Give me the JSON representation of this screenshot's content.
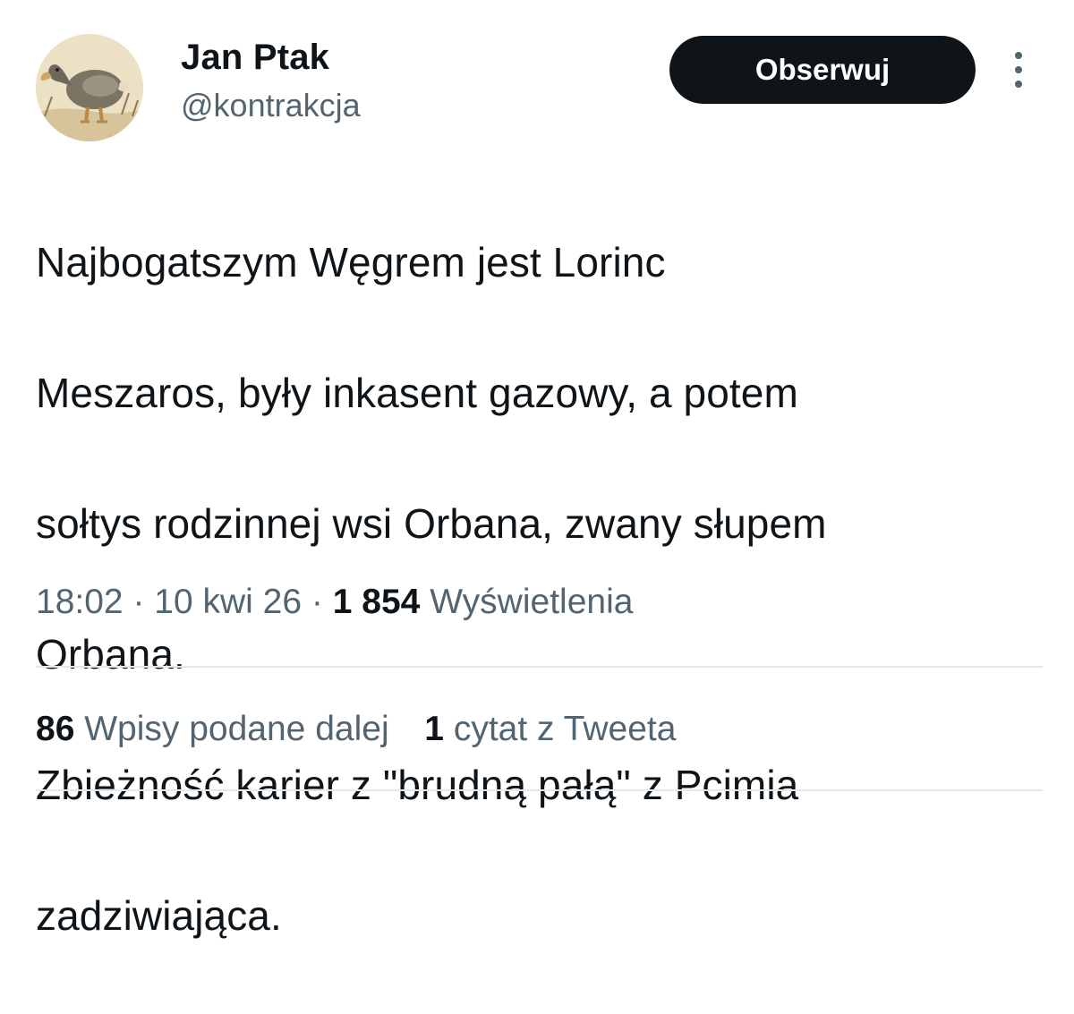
{
  "author": {
    "name": "Jan Ptak",
    "handle": "@kontrakcja",
    "avatar": "dodo-bird-avatar"
  },
  "actions": {
    "follow_label": "Obserwuj",
    "more_icon": "more-vertical-icon"
  },
  "tweet": {
    "lines": [
      "Najbogatszym Węgrem jest Lorinc",
      "Meszaros, były inkasent gazowy, a potem",
      "sołtys rodzinnej wsi Orbana, zwany słupem",
      "Orbana.",
      "Zbieżność karier z \"brudną pałą\" z Pcimia",
      "zadziwiająca."
    ]
  },
  "meta": {
    "time": "18:02",
    "separator": "·",
    "date": "10 kwi 26",
    "views_count": "1 854",
    "views_label": "Wyświetlenia"
  },
  "stats": {
    "retweets_count": "86",
    "retweets_label": "Wpisy podane dalej",
    "quotes_count": "1",
    "quotes_label": "cytat z Tweeta"
  },
  "colors": {
    "text_primary": "#0f1419",
    "text_secondary": "#536471",
    "button_bg": "#0f1419",
    "divider": "#e4e8eb"
  }
}
